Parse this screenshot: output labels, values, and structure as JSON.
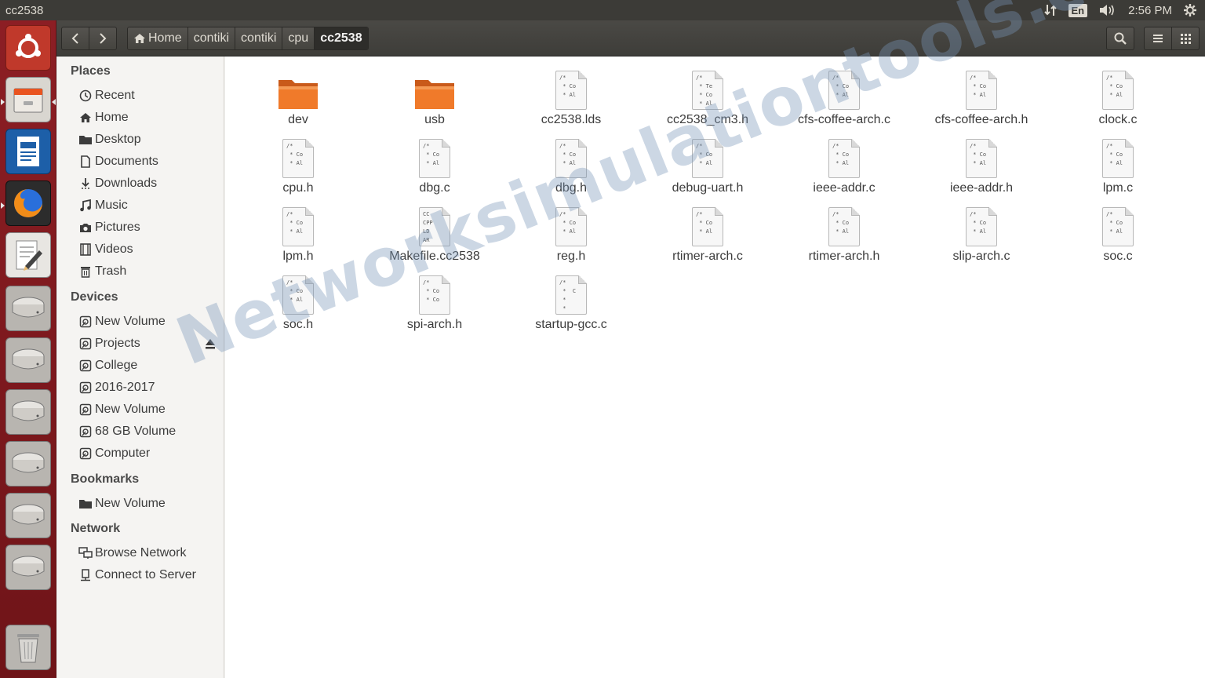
{
  "window": {
    "title": "cc2538"
  },
  "tray": {
    "keyboard": "En",
    "time": "2:56 PM"
  },
  "breadcrumbs": [
    {
      "label": "Home",
      "active": false
    },
    {
      "label": "contiki",
      "active": false
    },
    {
      "label": "contiki",
      "active": false
    },
    {
      "label": "cpu",
      "active": false
    },
    {
      "label": "cc2538",
      "active": true
    }
  ],
  "sidebar": {
    "places_title": "Places",
    "places": [
      {
        "label": "Recent",
        "icon": "clock-icon"
      },
      {
        "label": "Home",
        "icon": "home-icon"
      },
      {
        "label": "Desktop",
        "icon": "folder-icon"
      },
      {
        "label": "Documents",
        "icon": "document-icon"
      },
      {
        "label": "Downloads",
        "icon": "download-icon"
      },
      {
        "label": "Music",
        "icon": "music-icon"
      },
      {
        "label": "Pictures",
        "icon": "camera-icon"
      },
      {
        "label": "Videos",
        "icon": "film-icon"
      },
      {
        "label": "Trash",
        "icon": "trash-icon"
      }
    ],
    "devices_title": "Devices",
    "devices": [
      {
        "label": "New Volume",
        "icon": "drive-icon"
      },
      {
        "label": "Projects",
        "icon": "drive-icon"
      },
      {
        "label": "College",
        "icon": "drive-icon"
      },
      {
        "label": "2016-2017",
        "icon": "drive-icon"
      },
      {
        "label": "New Volume",
        "icon": "drive-icon"
      },
      {
        "label": "68 GB Volume",
        "icon": "drive-icon"
      },
      {
        "label": "Computer",
        "icon": "drive-icon"
      }
    ],
    "bookmarks_title": "Bookmarks",
    "bookmarks": [
      {
        "label": "New Volume",
        "icon": "folder-icon"
      }
    ],
    "network_title": "Network",
    "network": [
      {
        "label": "Browse Network",
        "icon": "network-icon"
      },
      {
        "label": "Connect to Server",
        "icon": "server-icon"
      }
    ]
  },
  "files": [
    {
      "name": "dev",
      "kind": "folder"
    },
    {
      "name": "usb",
      "kind": "folder"
    },
    {
      "name": "cc2538.lds",
      "kind": "text",
      "preview": "/*\n * Co\n * Al"
    },
    {
      "name": "cc2538_cm3.h",
      "kind": "text",
      "preview": "/*\n * Te\n * Co\n * Al"
    },
    {
      "name": "cfs-coffee-arch.c",
      "kind": "text",
      "preview": "/*\n * Co\n * Al"
    },
    {
      "name": "cfs-coffee-arch.h",
      "kind": "text",
      "preview": "/*\n * Co\n * Al"
    },
    {
      "name": "clock.c",
      "kind": "text",
      "preview": "/*\n * Co\n * Al"
    },
    {
      "name": "cpu.h",
      "kind": "text",
      "preview": "/*\n * Co\n * Al"
    },
    {
      "name": "dbg.c",
      "kind": "text",
      "preview": "/*\n * Co\n * Al"
    },
    {
      "name": "dbg.h",
      "kind": "text",
      "preview": "/*\n * Co\n * Al"
    },
    {
      "name": "debug-uart.h",
      "kind": "text",
      "preview": "/*\n * Co\n * Al"
    },
    {
      "name": "ieee-addr.c",
      "kind": "text",
      "preview": "/*\n * Co\n * Al"
    },
    {
      "name": "ieee-addr.h",
      "kind": "text",
      "preview": "/*\n * Co\n * Al"
    },
    {
      "name": "lpm.c",
      "kind": "text",
      "preview": "/*\n * Co\n * Al"
    },
    {
      "name": "lpm.h",
      "kind": "text",
      "preview": "/*\n * Co\n * Al"
    },
    {
      "name": "Makefile.cc2538",
      "kind": "text",
      "preview": "CC\nCPP\nLD\nAR"
    },
    {
      "name": "reg.h",
      "kind": "text",
      "preview": "/*\n * Co\n * Al"
    },
    {
      "name": "rtimer-arch.c",
      "kind": "text",
      "preview": "/*\n * Co\n * Al"
    },
    {
      "name": "rtimer-arch.h",
      "kind": "text",
      "preview": "/*\n * Co\n * Al"
    },
    {
      "name": "slip-arch.c",
      "kind": "text",
      "preview": "/*\n * Co\n * Al"
    },
    {
      "name": "soc.c",
      "kind": "text",
      "preview": "/*\n * Co\n * Al"
    },
    {
      "name": "soc.h",
      "kind": "text",
      "preview": "/*\n * Co\n * Al"
    },
    {
      "name": "spi-arch.h",
      "kind": "text",
      "preview": "/*\n * Co\n * Co"
    },
    {
      "name": "startup-gcc.c",
      "kind": "text",
      "preview": "/*\n *  C\n *\n *"
    }
  ],
  "watermark": "Networksimulationtools.com"
}
